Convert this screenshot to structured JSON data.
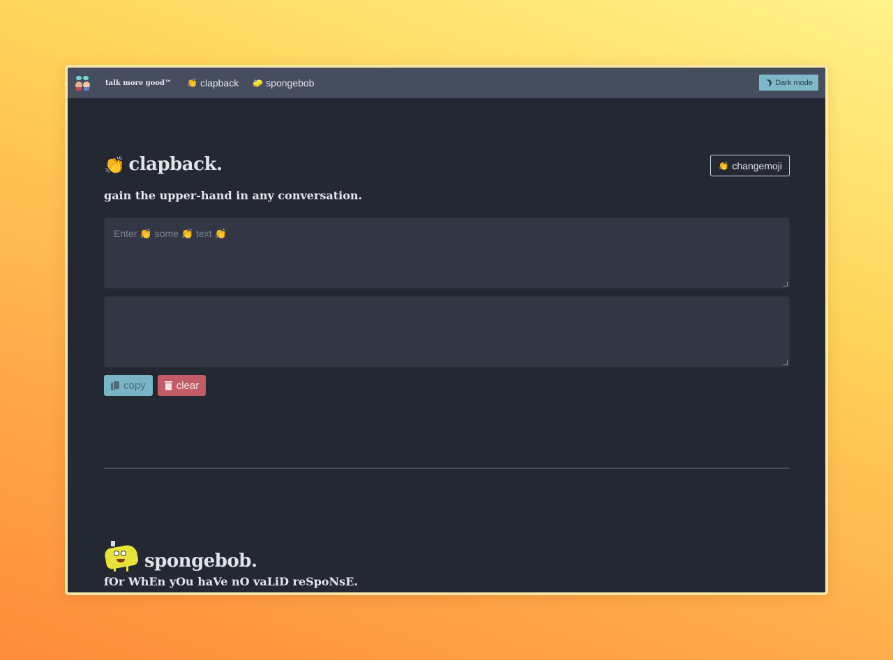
{
  "navbar": {
    "brand": "talk more good™",
    "links": [
      {
        "emoji": "👏",
        "label": "clapback"
      },
      {
        "emoji": "🧽",
        "label": "spongebob"
      }
    ],
    "dark_mode_label": "Dark mode"
  },
  "clapback": {
    "title_emoji": "👏",
    "title": "clapback.",
    "changemoji_emoji": "👏",
    "changemoji_label": "changemoji",
    "subtitle": "gain the upper-hand in any conversation.",
    "input_placeholder": "Enter 👏 some 👏 text 👏",
    "input_value": "",
    "output_value": "",
    "copy_label": "copy",
    "clear_label": "clear"
  },
  "spongebob": {
    "title": "spongebob.",
    "subtitle": "fOr WhEn yOu haVe nO vaLiD reSpoNsE."
  },
  "colors": {
    "background_panel": "#242832",
    "navbar": "#454d5f",
    "copy_button": "#7ab5c6",
    "clear_button": "#c25d68",
    "dark_mode_button": "#7fb8c8"
  }
}
